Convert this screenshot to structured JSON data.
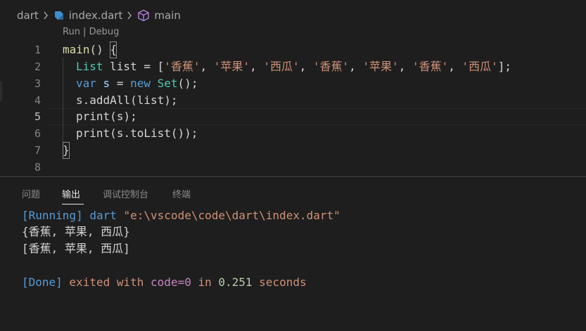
{
  "breadcrumb": {
    "folder": "dart",
    "file": "index.dart",
    "symbol": "main"
  },
  "codelens": "Run | Debug",
  "gutter": [
    "1",
    "2",
    "3",
    "4",
    "5",
    "6",
    "7",
    "8"
  ],
  "code": {
    "l1": {
      "fn": "main",
      "rest": "() ",
      "brace": "{"
    },
    "l2": {
      "type": "List",
      "decl": " list = [",
      "s1": "'香蕉'",
      "c1": ", ",
      "s2": "'苹果'",
      "c2": ", ",
      "s3": "'西瓜'",
      "c3": ", ",
      "s4": "'香蕉'",
      "c4": ", ",
      "s5": "'苹果'",
      "c5": ", ",
      "s6": "'香蕉'",
      "c6": ", ",
      "s7": "'西瓜'",
      "end": "];"
    },
    "l3": {
      "kw": "var",
      "var": "s",
      "eq": " = ",
      "kw2": "new",
      "type": "Set",
      "end": "();"
    },
    "l4": {
      "obj": "s",
      "dot": ".",
      "fn": "addAll",
      "end": "(list);"
    },
    "l5": {
      "fn": "print",
      "open": "(",
      "arg": "s",
      "end": ");"
    },
    "l6": {
      "fn": "print",
      "open": "(",
      "obj": "s",
      "dot": ".",
      "fn2": "toList",
      "end": "());"
    },
    "l7": {
      "brace": "}"
    }
  },
  "panel": {
    "tabs": [
      "问题",
      "输出",
      "调试控制台",
      "终端"
    ],
    "active_tab": "输出"
  },
  "output": {
    "running_tag": "[Running]",
    "running_cmd": " dart ",
    "running_path": "\"e:\\vscode\\code\\dart\\index.dart\"",
    "line2": "{香蕉, 苹果, 西瓜}",
    "line3": "[香蕉, 苹果, 西瓜]",
    "done_tag": "[Done]",
    "done_exited": " exited with ",
    "done_code": "code=0",
    "done_in": " in ",
    "done_time": "0.251",
    "done_seconds": " seconds"
  },
  "colors": {
    "background": "#1e1e1e",
    "keyword": "#569cd6",
    "string": "#ce9178",
    "function": "#dcdcaa",
    "type": "#4ec9b0",
    "variable": "#9cdcfe"
  },
  "icons": {
    "file_icon": "dart-file-icon",
    "symbol_icon": "cube-method-icon"
  }
}
